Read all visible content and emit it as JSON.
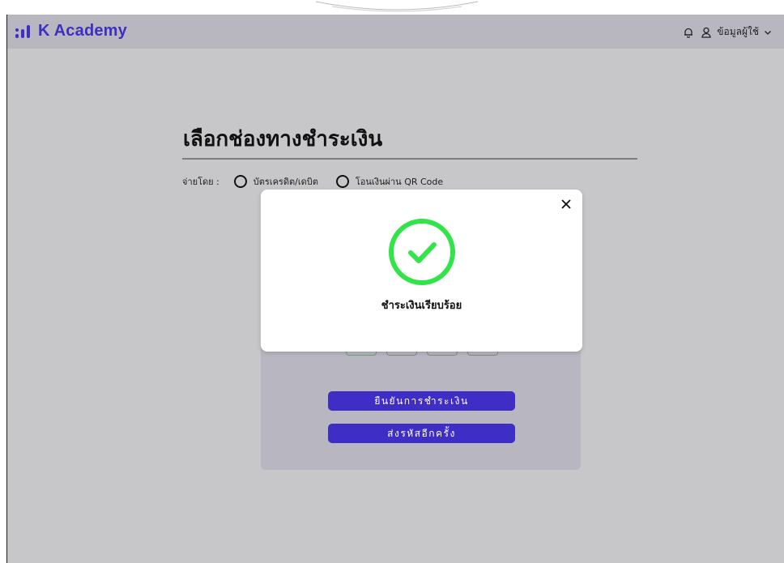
{
  "header": {
    "logo_text": "K Academy",
    "user_label": "ข้อมูลผู้ใช้",
    "brand_color": "#3d2fc4"
  },
  "page": {
    "title": "เลือกช่องทางชำระเงิน",
    "pay_by_label": "จ่ายโดย :",
    "options": [
      {
        "label": "บัตรเครดิต/เดบิต",
        "selected": false
      },
      {
        "label": "โอนเงินผ่าน QR Code",
        "selected": false
      }
    ]
  },
  "card": {
    "confirm_button": "ยืนยันการชำระเงิน",
    "resend_button": "ส่งรหัสอีกครั้ง",
    "otp_boxes": 4
  },
  "modal": {
    "message": "ชำระเงินเรียบร้อย",
    "close_icon": "close-icon",
    "success_icon": "check-circle-icon",
    "success_color": "#33e34a"
  }
}
